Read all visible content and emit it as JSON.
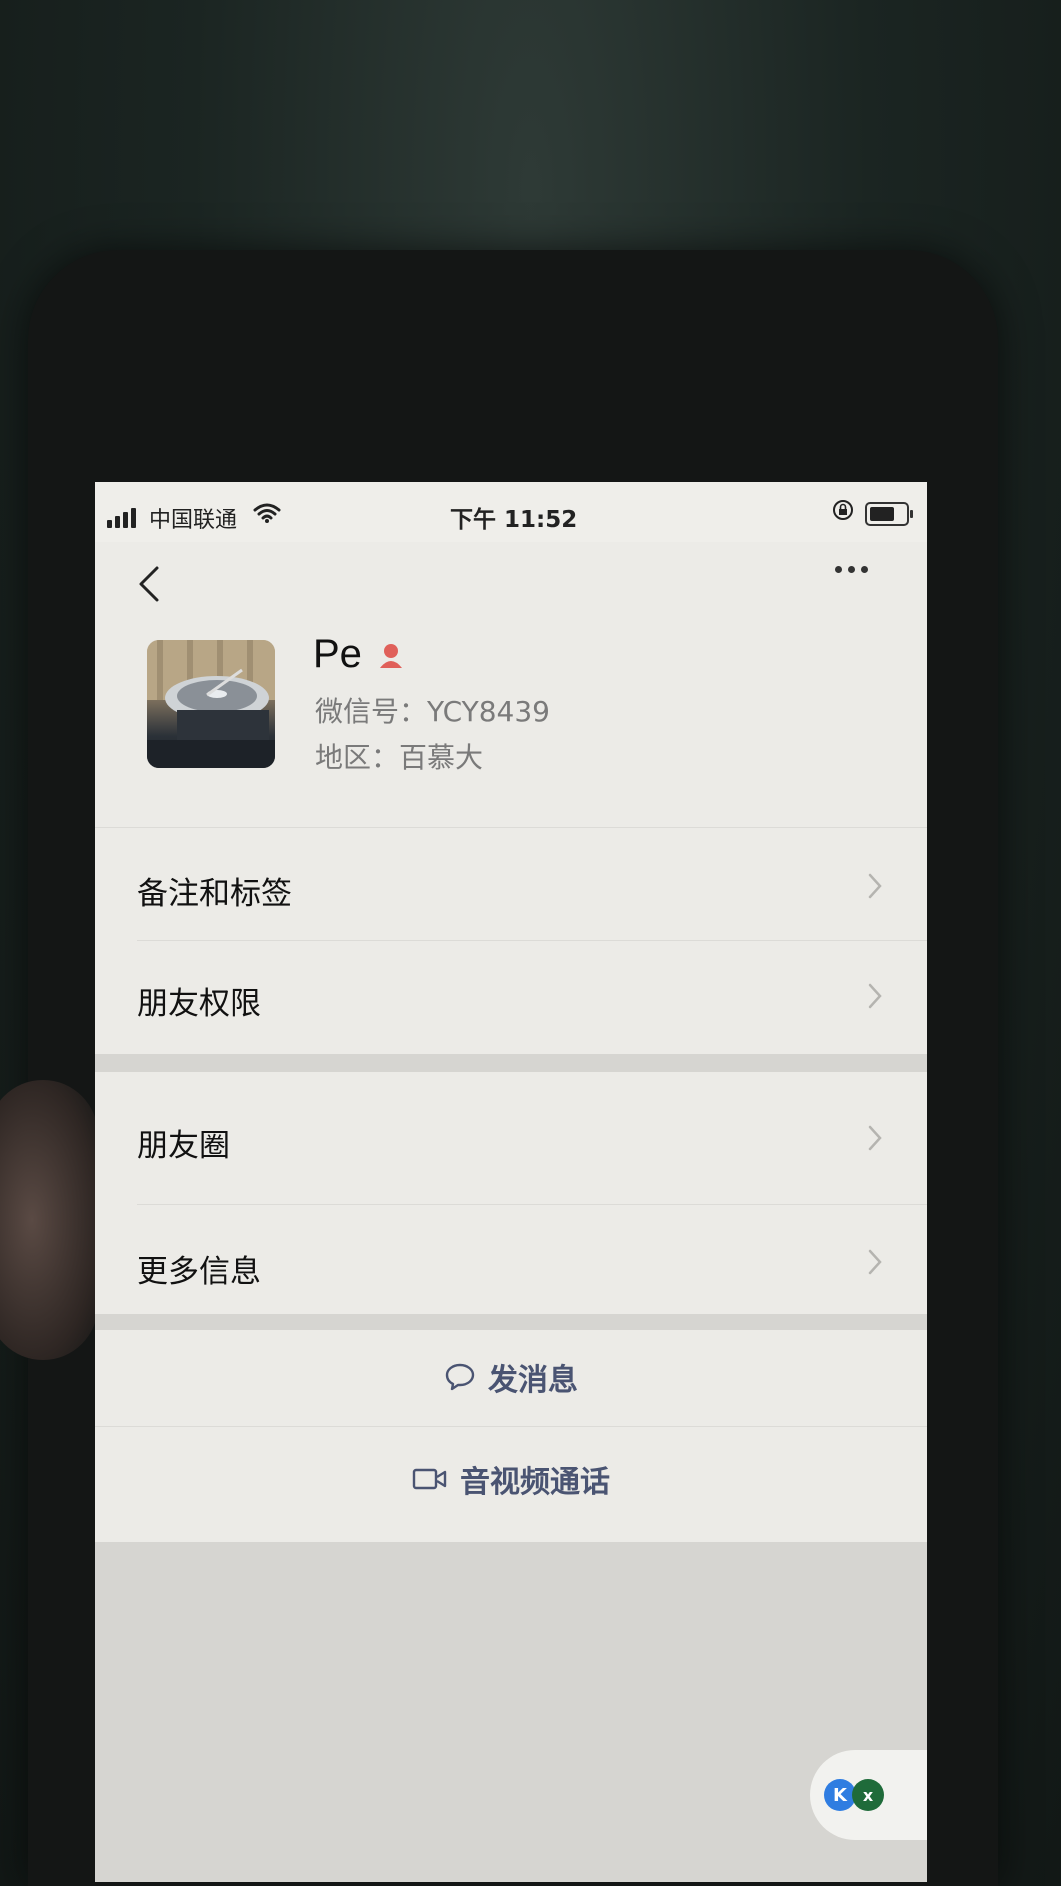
{
  "status_bar": {
    "carrier": "中国联通",
    "time": "下午 11:52"
  },
  "nav": {
    "back_icon": "chevron-left-icon",
    "more_icon": "more-dots-icon"
  },
  "profile": {
    "name": "Pe",
    "gender_icon": "female-icon",
    "wechat_id": "微信号：YCY8439",
    "region": "地区：百慕大"
  },
  "list": {
    "items": [
      {
        "label": "备注和标签"
      },
      {
        "label": "朋友权限"
      },
      {
        "label": "朋友圈"
      },
      {
        "label": "更多信息"
      }
    ]
  },
  "actions": {
    "send_message": "发消息",
    "video_call": "音视频通话"
  },
  "colors": {
    "action_text": "#4a5472",
    "gender_icon": "#e0605a"
  }
}
